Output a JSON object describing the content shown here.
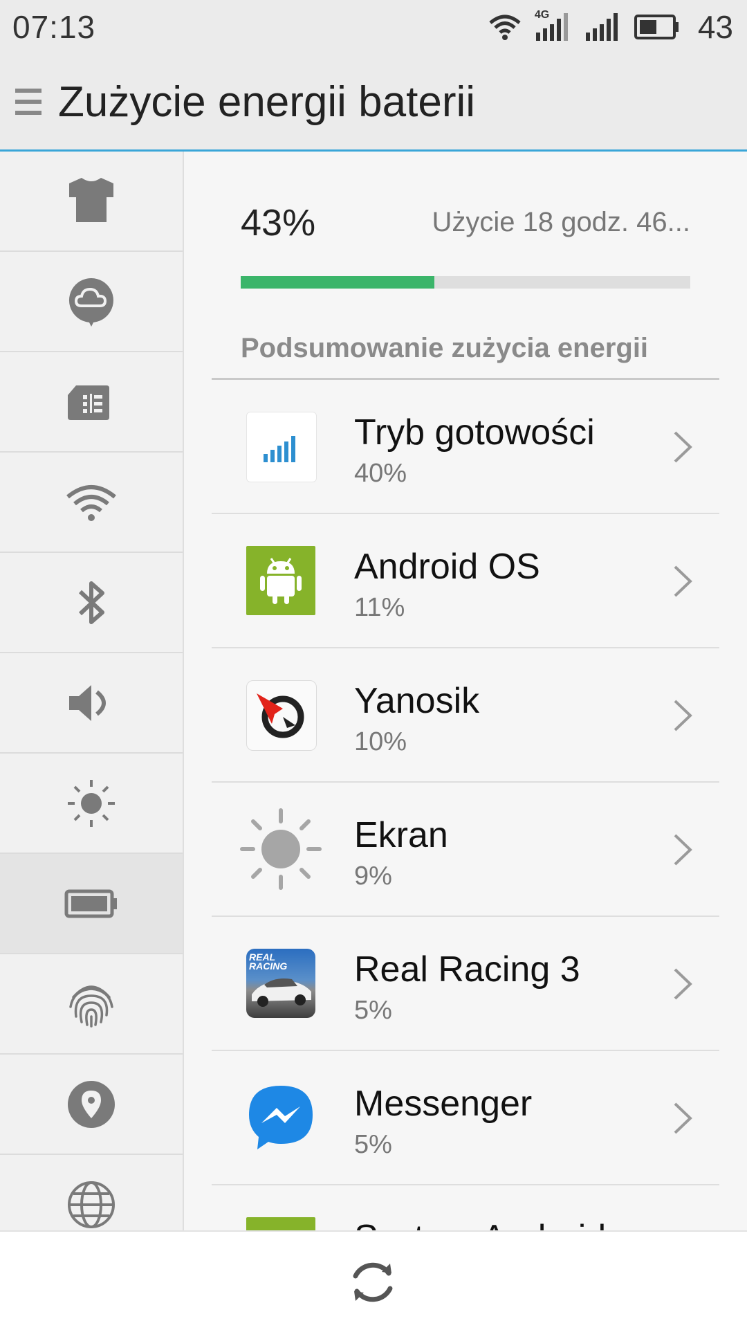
{
  "status_bar": {
    "time": "07:13",
    "battery_level": "43",
    "network": "4G"
  },
  "title_bar": {
    "title": "Zużycie energii baterii"
  },
  "sidebar": {
    "items": [
      {
        "name": "theme",
        "icon": "tshirt-icon"
      },
      {
        "name": "cloud",
        "icon": "cloud-icon"
      },
      {
        "name": "sim",
        "icon": "sim-card-icon"
      },
      {
        "name": "wifi",
        "icon": "wifi-icon"
      },
      {
        "name": "bluetooth",
        "icon": "bluetooth-icon"
      },
      {
        "name": "sound",
        "icon": "speaker-icon"
      },
      {
        "name": "display",
        "icon": "brightness-icon"
      },
      {
        "name": "battery",
        "icon": "battery-icon",
        "active": true
      },
      {
        "name": "fingerprint",
        "icon": "fingerprint-icon"
      },
      {
        "name": "location",
        "icon": "location-pin-icon"
      },
      {
        "name": "language",
        "icon": "globe-icon"
      }
    ]
  },
  "battery": {
    "percent_text": "43%",
    "level": 0.43,
    "usage_text": "Użycie 18 godz. 46...",
    "accent_color": "#3bb56a"
  },
  "section": {
    "title": "Podsumowanie zużycia energii"
  },
  "apps": [
    {
      "name": "Tryb gotowości",
      "percent": "40%",
      "icon": "signal-bars-icon"
    },
    {
      "name": "Android OS",
      "percent": "11%",
      "icon": "android-icon"
    },
    {
      "name": "Yanosik",
      "percent": "10%",
      "icon": "yanosik-icon"
    },
    {
      "name": "Ekran",
      "percent": "9%",
      "icon": "brightness-icon"
    },
    {
      "name": "Real Racing 3",
      "percent": "5%",
      "icon": "real-racing-icon",
      "icon_text": "REAL RACING"
    },
    {
      "name": "Messenger",
      "percent": "5%",
      "icon": "messenger-icon"
    },
    {
      "name": "System Android",
      "percent": "",
      "icon": "android-system-icon"
    }
  ],
  "bottom_bar": {
    "icon": "refresh-icon"
  }
}
